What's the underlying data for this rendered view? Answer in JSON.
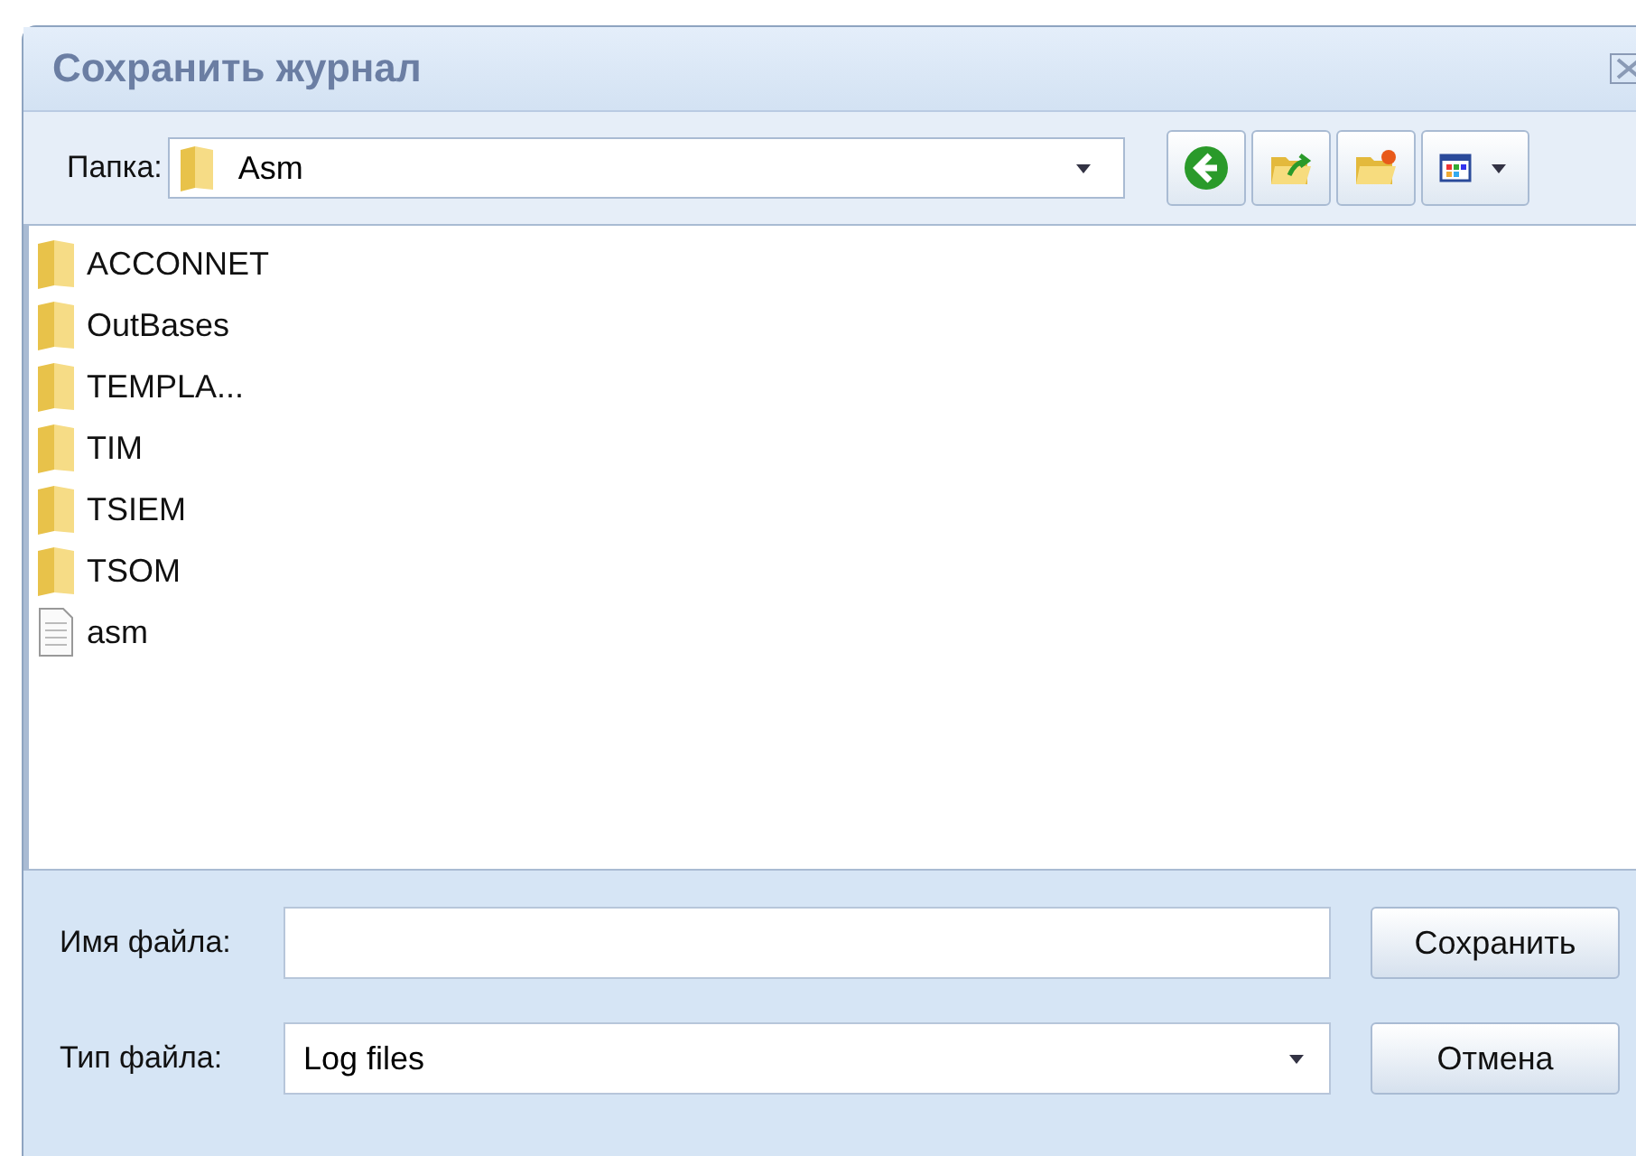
{
  "window": {
    "title": "Сохранить журнал"
  },
  "toolbar": {
    "folder_label": "Папка:",
    "folder": "Asm"
  },
  "files": [
    {
      "name": "ACCONNET",
      "kind": "folder"
    },
    {
      "name": "OutBases",
      "kind": "folder"
    },
    {
      "name": "TEMPLA...",
      "kind": "folder"
    },
    {
      "name": "TIM",
      "kind": "folder"
    },
    {
      "name": "TSIEM",
      "kind": "folder"
    },
    {
      "name": "TSOM",
      "kind": "folder"
    },
    {
      "name": "asm",
      "kind": "file"
    }
  ],
  "filename": {
    "label": "Имя файла:"
  },
  "filetype": {
    "label": "Тип файла:",
    "value": "Log files"
  },
  "buttons": [
    "Сохранить",
    "Отмена"
  ]
}
